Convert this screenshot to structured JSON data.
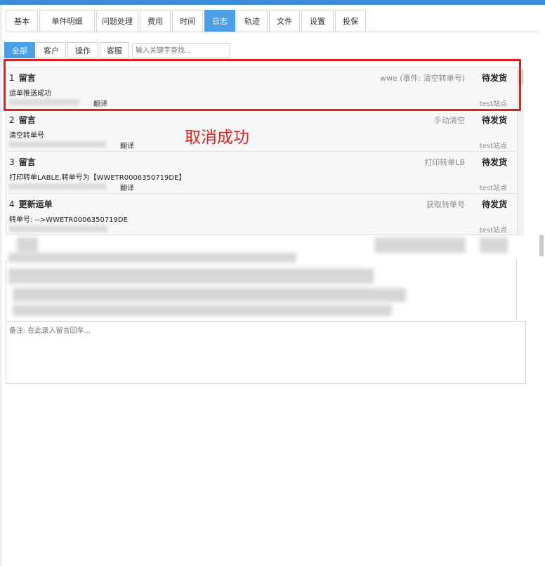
{
  "tabs": [
    "基本",
    "单件明细",
    "问题处理",
    "费用",
    "时间",
    "日志",
    "轨迹",
    "文件",
    "设置",
    "投保"
  ],
  "active_tab": "日志",
  "subtabs": [
    "全部",
    "客户",
    "操作",
    "客服"
  ],
  "active_subtab": "全部",
  "search": {
    "placeholder": "输入关键字查找..."
  },
  "logs": [
    {
      "index": "1",
      "type": "留言",
      "event": "wwe (事件: 清空转单号)",
      "status": "待发货",
      "content": "运单推送成功",
      "translate": "翻译",
      "site": "test站点"
    },
    {
      "index": "2",
      "type": "留言",
      "event": "手动清空",
      "status": "待发货",
      "content": "清空转单号",
      "translate": "翻译",
      "site": "test站点"
    },
    {
      "index": "3",
      "type": "留言",
      "event": "打印转单LB",
      "status": "待发货",
      "content": "打印转单LABLE,转单号为【WWETR0006350719DE】",
      "translate": "翻译",
      "site": "test站点"
    },
    {
      "index": "4",
      "type": "更新运单",
      "event": "获取转单号",
      "status": "待发货",
      "content": "转单号: -->WWETR0006350719DE",
      "translate": "",
      "site": "test站点"
    }
  ],
  "toast": "取消成功",
  "remark": {
    "placeholder": "备注: 在此录入留言回车..."
  },
  "colors": {
    "accent": "#4a9fe7",
    "highlight": "#e02020"
  }
}
